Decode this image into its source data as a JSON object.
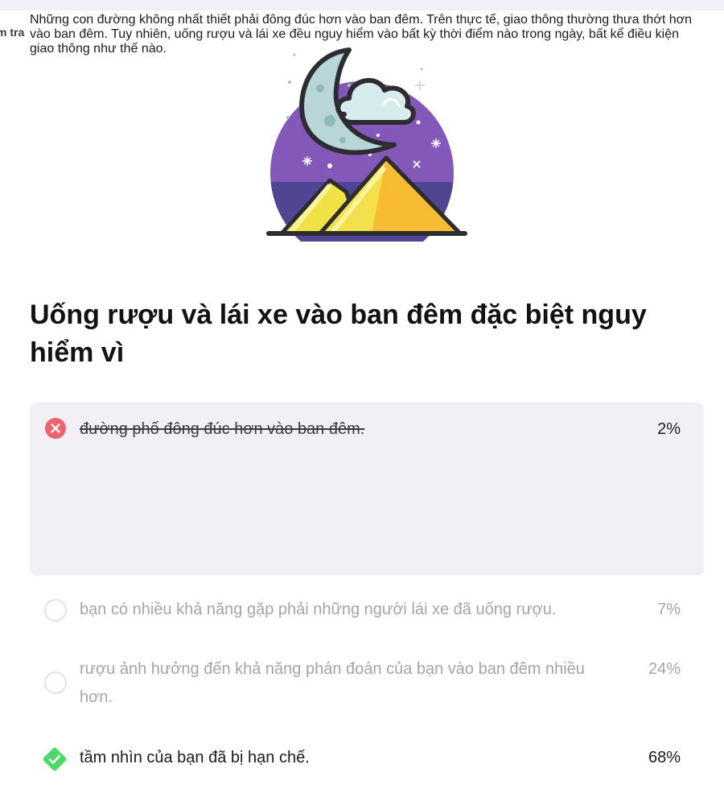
{
  "breadcrumb": {
    "label": "m tra"
  },
  "illustration": {
    "icon": "moon-mountains-icon"
  },
  "question": {
    "title": "Uống rượu và lái xe vào ban đêm đặc biệt nguy hiểm vì"
  },
  "options": [
    {
      "label": "đường phố đông đúc hơn vào ban đêm.",
      "percent": "2%",
      "state": "selected-incorrect",
      "explanation": "Những con đường không nhất thiết phải đông đúc hơn vào ban đêm. Trên thực tế, giao thông thường thưa thớt hơn vào ban đêm. Tuy nhiên, uống rượu và lái xe đều nguy hiểm vào bất kỳ thời điểm nào trong ngày, bất kể điều kiện giao thông như thế nào."
    },
    {
      "label": "bạn có nhiều khả năng gặp phải những người lái xe đã uống rượu.",
      "percent": "7%",
      "state": "unselected"
    },
    {
      "label": "rượu ảnh hưởng đến khả năng phán đoán của bạn vào ban đêm nhiều hơn.",
      "percent": "24%",
      "state": "unselected"
    },
    {
      "label": "tầm nhìn của bạn đã bị hạn chế.",
      "percent": "68%",
      "state": "correct"
    }
  ],
  "colors": {
    "incorrect": "#f0626f",
    "correct": "#4fd76a",
    "selected_bg": "#f1f1f5",
    "muted_text": "#a4a4aa"
  }
}
